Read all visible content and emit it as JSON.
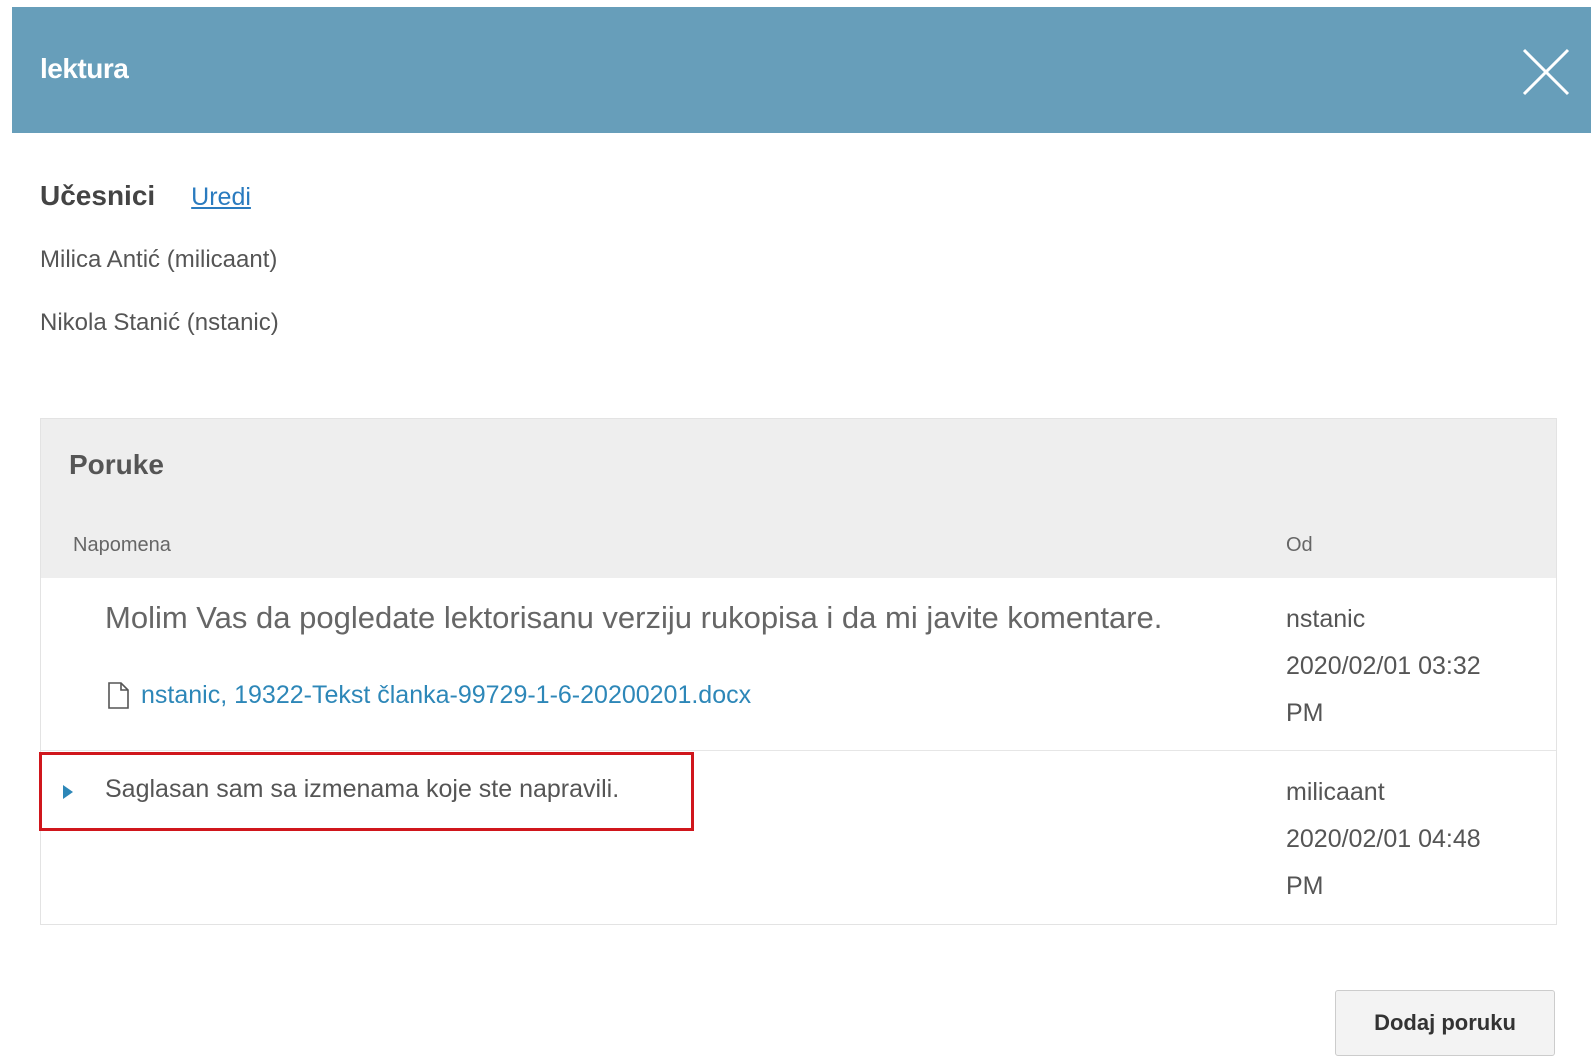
{
  "header": {
    "title": "lektura",
    "close_icon": "close-icon",
    "background_color": "#679eba"
  },
  "participants": {
    "title": "Učesnici",
    "edit_label": "Uredi",
    "items": [
      "Milica Antić (milicaant)",
      "Nikola Stanić (nstanic)"
    ]
  },
  "messages": {
    "title": "Poruke",
    "columns": {
      "note": "Napomena",
      "from": "Od"
    },
    "rows": [
      {
        "text": "Molim Vas da pogledate lektorisanu verziju rukopisa i da mi javite komentare.",
        "file_icon": "file-icon",
        "file_name": "nstanic, 19322-Tekst članka-99729-1-6-20200201.docx",
        "author": "nstanic",
        "date": "2020/02/01 03:32",
        "time_suffix": "PM"
      },
      {
        "expand_icon": "triangle-right-icon",
        "text": "Saglasan sam sa izmenama koje ste napravili.",
        "author": "milicaant",
        "date": "2020/02/01 04:48",
        "time_suffix": "PM",
        "highlight_color": "#d0161c"
      }
    ]
  },
  "actions": {
    "add_message_label": "Dodaj poruku"
  }
}
